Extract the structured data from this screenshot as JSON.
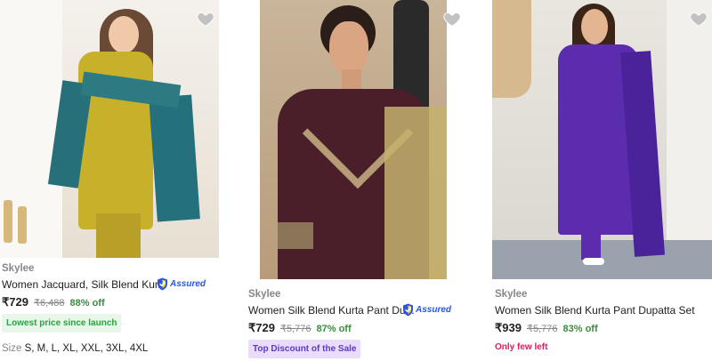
{
  "products": [
    {
      "brand": "Skylee",
      "title": "Women Jacquard, Silk Blend Kur...",
      "assured": "Assured",
      "price": "₹729",
      "mrp": "₹6,488",
      "discount": "88% off",
      "tag": "Lowest price since launch",
      "size_label": "Size",
      "sizes": "S, M, L, XL, XXL, 3XL, 4XL",
      "icon": "heart-icon"
    },
    {
      "brand": "Skylee",
      "title": "Women Silk Blend Kurta Pant Du...",
      "assured": "Assured",
      "price": "₹729",
      "mrp": "₹5,776",
      "discount": "87% off",
      "tag": "Top Discount of the Sale",
      "icon": "heart-icon"
    },
    {
      "brand": "Skylee",
      "title": "Women Silk Blend Kurta Pant Dupatta Set",
      "price": "₹939",
      "mrp": "₹5,776",
      "discount": "83% off",
      "tag": "Only few left",
      "icon": "heart-icon"
    }
  ],
  "colors": {
    "discount": "#388e3c",
    "assured": "#2a55e5",
    "few_left": "#e31c5a",
    "tag_green_bg": "#e8f7ea",
    "tag_purple_bg": "#e9dcff"
  }
}
